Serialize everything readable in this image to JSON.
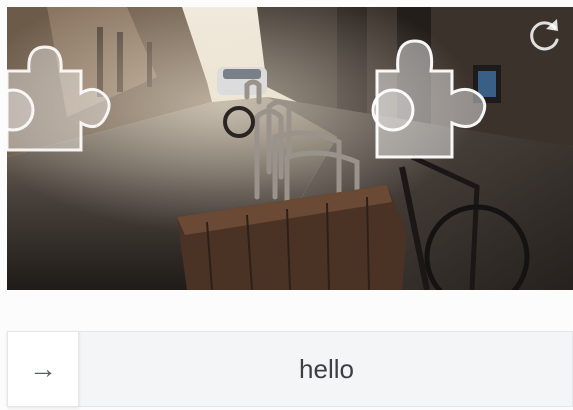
{
  "captcha": {
    "refresh_icon": "refresh-icon",
    "slider": {
      "handle_icon": "arrow-right-icon",
      "handle_glyph": "→",
      "track_text": "hello"
    }
  },
  "colors": {
    "track_bg": "#f3f5f7",
    "track_border": "#e4e7ea",
    "handle_bg": "#ffffff",
    "arrow": "#5a5f65",
    "text": "#3c3f43"
  }
}
